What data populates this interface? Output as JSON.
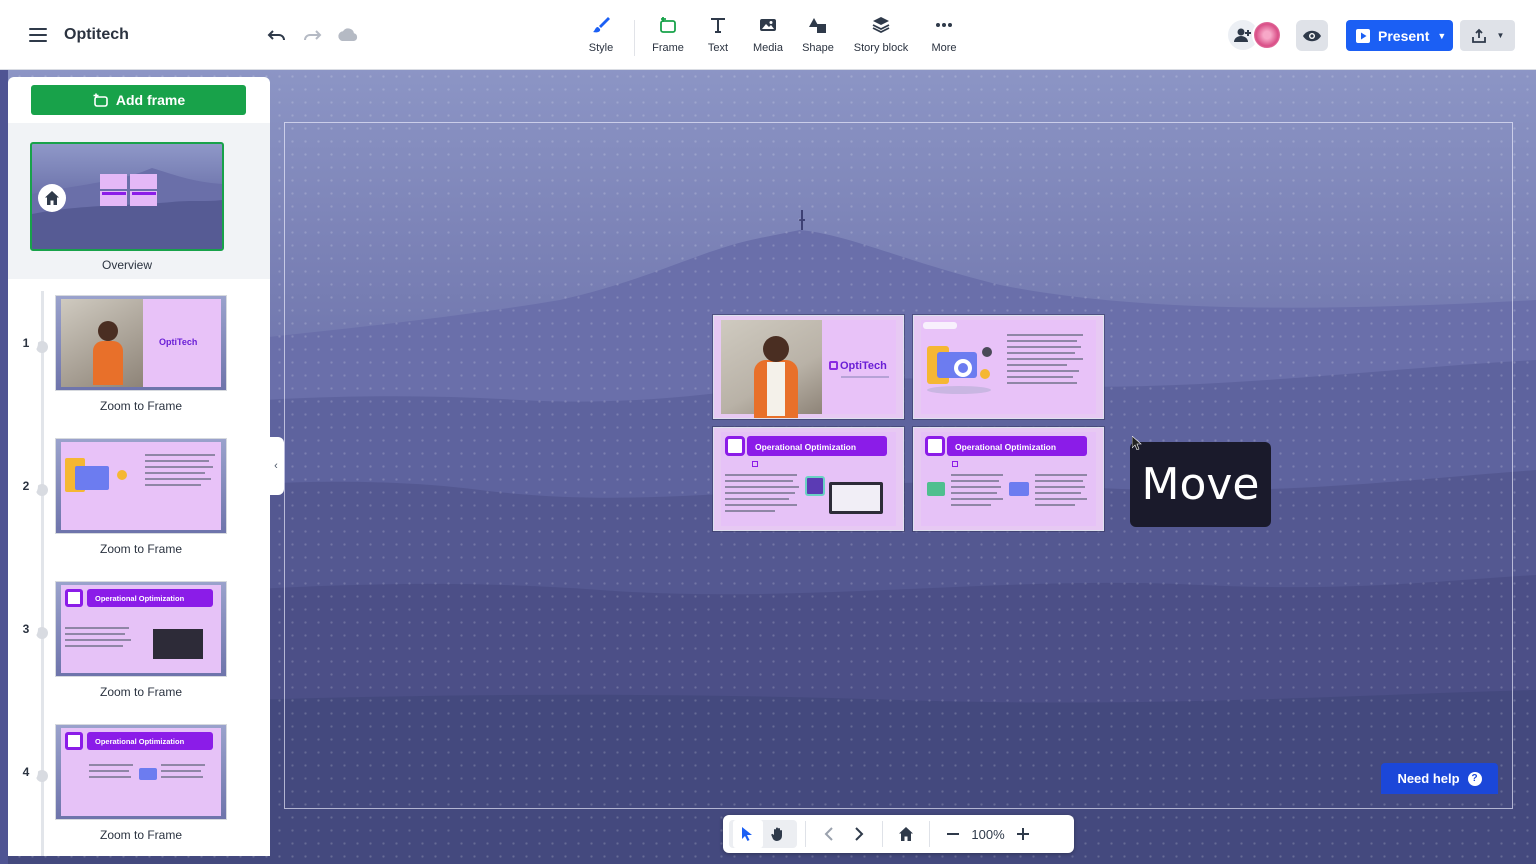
{
  "app": {
    "title": "Optitech"
  },
  "toolbar": {
    "tools": [
      {
        "label": "Style",
        "icon": "brush-icon"
      },
      {
        "label": "Frame",
        "icon": "frame-icon"
      },
      {
        "label": "Text",
        "icon": "text-icon"
      },
      {
        "label": "Media",
        "icon": "image-icon"
      },
      {
        "label": "Shape",
        "icon": "shape-icon"
      },
      {
        "label": "Story block",
        "icon": "story-block-icon"
      },
      {
        "label": "More",
        "icon": "more-dots-icon"
      }
    ],
    "present_label": "Present"
  },
  "sidebar": {
    "add_frame_label": "Add frame",
    "overview_label": "Overview",
    "items": [
      {
        "number": "1",
        "caption": "Zoom to Frame"
      },
      {
        "number": "2",
        "caption": "Zoom to Frame"
      },
      {
        "number": "3",
        "caption": "Zoom to Frame"
      },
      {
        "number": "4",
        "caption": "Zoom to Frame"
      }
    ]
  },
  "canvas": {
    "slides": {
      "brand": "OptiTech",
      "header_title": "Operational Optimization",
      "tag_label": "Optimization"
    },
    "tooltip": "Move"
  },
  "navigation": {
    "zoom": "100%"
  },
  "help": {
    "label": "Need help",
    "q": "?"
  },
  "colors": {
    "accent": "#1b5ff4",
    "add_frame": "#18a24a",
    "slide_purple": "#8b1ce8",
    "help": "#1b47d9"
  }
}
